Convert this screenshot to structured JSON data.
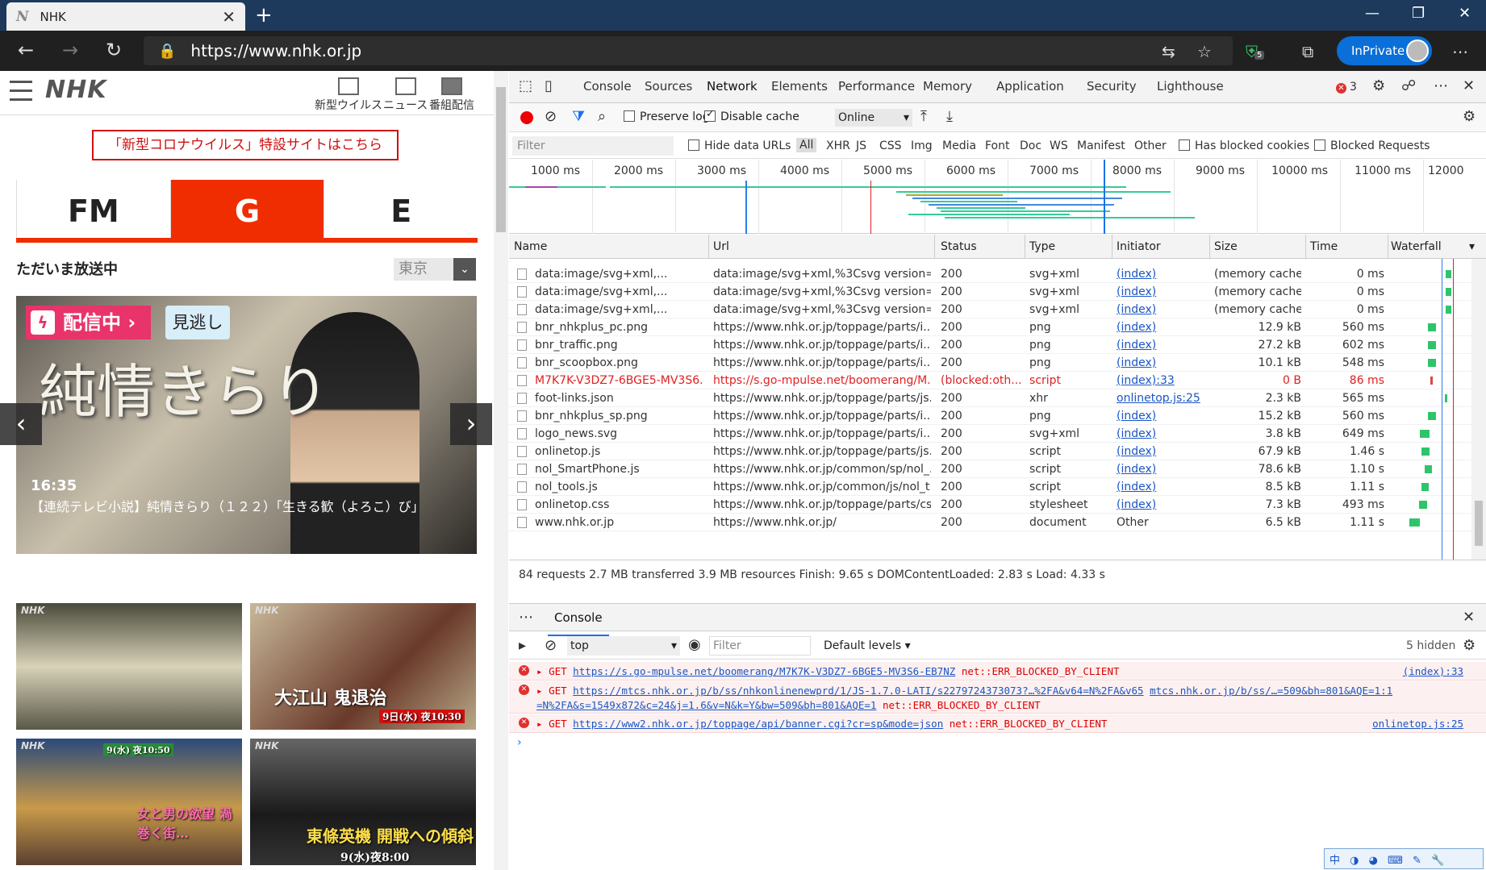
{
  "browser": {
    "tab_title": "NHK",
    "tab_favicon": "N",
    "url": "https://www.nhk.or.jp",
    "inprivate_label": "InPrivate",
    "shield_badge": "5"
  },
  "page": {
    "logo": "NHK",
    "header_buttons": [
      "新型ウイルス",
      "ニュース",
      "番組配信"
    ],
    "corona_banner": "「新型コロナウイルス」特設サイトはこちら",
    "channels": [
      "FM",
      "G",
      "E"
    ],
    "active_channel": "G",
    "on_air_label": "ただいま放送中",
    "region": "東京",
    "hero": {
      "live_badge": "配信中",
      "catchup_button": "見逃し",
      "title_art": "純情きらり",
      "time": "16:35",
      "description": "【連続テレビ小説】純情きらり（１２２）「生きる歓（よろこ）び」"
    },
    "thumbs": [
      {
        "caption": "大江山 鬼退治",
        "badge": "9日(水) 夜10:30"
      },
      {
        "caption": "女と男の欲望 渦巻く街…",
        "badge": "9(水) 夜10:50"
      },
      {
        "caption": "東條英機 開戦への傾斜",
        "badge": "9(水)夜8:00"
      }
    ]
  },
  "devtools": {
    "tabs": [
      "Console",
      "Sources",
      "Network",
      "Elements",
      "Performance",
      "Memory",
      "Application",
      "Security",
      "Lighthouse"
    ],
    "active_tab": "Network",
    "error_count": "3",
    "toolbar": {
      "preserve_log": "Preserve log",
      "disable_cache": "Disable cache",
      "throttle": "Online"
    },
    "filter": {
      "placeholder": "Filter",
      "hide_data_urls": "Hide data URLs",
      "types": [
        "All",
        "XHR",
        "JS",
        "CSS",
        "Img",
        "Media",
        "Font",
        "Doc",
        "WS",
        "Manifest",
        "Other"
      ],
      "has_blocked_cookies": "Has blocked cookies",
      "blocked_requests": "Blocked Requests"
    },
    "timeline_ticks": [
      "1000 ms",
      "2000 ms",
      "3000 ms",
      "4000 ms",
      "5000 ms",
      "6000 ms",
      "7000 ms",
      "8000 ms",
      "9000 ms",
      "10000 ms",
      "11000 ms",
      "12000"
    ],
    "columns": [
      "Name",
      "Url",
      "Status",
      "Type",
      "Initiator",
      "Size",
      "Time",
      "Waterfall"
    ],
    "rows": [
      {
        "name": "data:image/svg+xml,...",
        "url": "data:image/svg+xml,%3Csvg version='...",
        "status": "200",
        "type": "svg+xml",
        "initiator": "(index)",
        "size": "(memory cache)",
        "time": "0 ms"
      },
      {
        "name": "data:image/svg+xml,...",
        "url": "data:image/svg+xml,%3Csvg version='...",
        "status": "200",
        "type": "svg+xml",
        "initiator": "(index)",
        "size": "(memory cache)",
        "time": "0 ms"
      },
      {
        "name": "data:image/svg+xml,...",
        "url": "data:image/svg+xml,%3Csvg version='...",
        "status": "200",
        "type": "svg+xml",
        "initiator": "(index)",
        "size": "(memory cache)",
        "time": "0 ms"
      },
      {
        "name": "bnr_nhkplus_pc.png",
        "url": "https://www.nhk.or.jp/toppage/parts/i...",
        "status": "200",
        "type": "png",
        "initiator": "(index)",
        "size": "12.9 kB",
        "time": "560 ms"
      },
      {
        "name": "bnr_traffic.png",
        "url": "https://www.nhk.or.jp/toppage/parts/i...",
        "status": "200",
        "type": "png",
        "initiator": "(index)",
        "size": "27.2 kB",
        "time": "602 ms"
      },
      {
        "name": "bnr_scoopbox.png",
        "url": "https://www.nhk.or.jp/toppage/parts/i...",
        "status": "200",
        "type": "png",
        "initiator": "(index)",
        "size": "10.1 kB",
        "time": "548 ms"
      },
      {
        "name": "M7K7K-V3DZ7-6BGE5-MV3S6...",
        "url": "https://s.go-mpulse.net/boomerang/M...",
        "status": "(blocked:oth...",
        "type": "script",
        "initiator": "(index):33",
        "size": "0 B",
        "time": "86 ms",
        "error": true
      },
      {
        "name": "foot-links.json",
        "url": "https://www.nhk.or.jp/toppage/parts/js...",
        "status": "200",
        "type": "xhr",
        "initiator": "onlinetop.js:25",
        "size": "2.3 kB",
        "time": "565 ms"
      },
      {
        "name": "bnr_nhkplus_sp.png",
        "url": "https://www.nhk.or.jp/toppage/parts/i...",
        "status": "200",
        "type": "png",
        "initiator": "(index)",
        "size": "15.2 kB",
        "time": "560 ms"
      },
      {
        "name": "logo_news.svg",
        "url": "https://www.nhk.or.jp/toppage/parts/i...",
        "status": "200",
        "type": "svg+xml",
        "initiator": "(index)",
        "size": "3.8 kB",
        "time": "649 ms"
      },
      {
        "name": "onlinetop.js",
        "url": "https://www.nhk.or.jp/toppage/parts/js...",
        "status": "200",
        "type": "script",
        "initiator": "(index)",
        "size": "67.9 kB",
        "time": "1.46 s"
      },
      {
        "name": "nol_SmartPhone.js",
        "url": "https://www.nhk.or.jp/common/sp/nol_...",
        "status": "200",
        "type": "script",
        "initiator": "(index)",
        "size": "78.6 kB",
        "time": "1.10 s"
      },
      {
        "name": "nol_tools.js",
        "url": "https://www.nhk.or.jp/common/js/nol_t...",
        "status": "200",
        "type": "script",
        "initiator": "(index)",
        "size": "8.5 kB",
        "time": "1.11 s"
      },
      {
        "name": "onlinetop.css",
        "url": "https://www.nhk.or.jp/toppage/parts/cs...",
        "status": "200",
        "type": "stylesheet",
        "initiator": "(index)",
        "size": "7.3 kB",
        "time": "493 ms"
      },
      {
        "name": "www.nhk.or.jp",
        "url": "https://www.nhk.or.jp/",
        "status": "200",
        "type": "document",
        "initiator": "Other",
        "size": "6.5 kB",
        "time": "1.11 s"
      }
    ],
    "summary": "84 requests   2.7 MB transferred   3.9 MB resources   Finish: 9.65 s   DOMContentLoaded: 2.83 s   Load: 4.33 s",
    "drawer": {
      "tab": "Console",
      "context": "top",
      "filter_placeholder": "Filter",
      "levels": "Default levels",
      "hidden": "5 hidden",
      "messages": [
        {
          "method": "GET",
          "url": "https://s.go-mpulse.net/boomerang/M7K7K-V3DZ7-6BGE5-MV3S6-EB7NZ",
          "error": "net::ERR_BLOCKED_BY_CLIENT",
          "source": "(index):33"
        },
        {
          "method": "GET",
          "url": "https://mtcs.nhk.or.jp/b/ss/nhkonlinenewprd/1/JS-1.7.0-LATI/s2279724373073?…%2FA&v64=N%2FA&v65",
          "url2": "mtcs.nhk.or.jp/b/ss/…=509&bh=801&AQE=1:1",
          "cont": "=N%2FA&s=1549x872&c=24&j=1.6&v=N&k=Y&bw=509&bh=801&AQE=1",
          "error": "net::ERR_BLOCKED_BY_CLIENT"
        },
        {
          "method": "GET",
          "url": "https://www2.nhk.or.jp/toppage/api/banner.cgi?cr=sp&mode=json",
          "error": "net::ERR_BLOCKED_BY_CLIENT",
          "source": "onlinetop.js:25"
        }
      ]
    }
  },
  "ime": "中 ◑ ◕ ⌨ ✎ 🔧"
}
